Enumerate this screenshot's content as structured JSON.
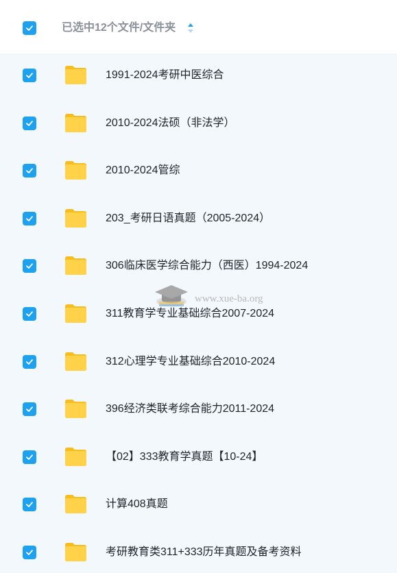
{
  "header": {
    "selection_text": "已选中12个文件/文件夹",
    "checked": true
  },
  "colors": {
    "accent": "#1ea1ee",
    "folder": "#ffcf3d",
    "row_bg": "#f3f8fd"
  },
  "items": [
    {
      "label": "1991-2024考研中医综合",
      "checked": true,
      "icon": "folder-icon"
    },
    {
      "label": "2010-2024法硕（非法学）",
      "checked": true,
      "icon": "folder-icon"
    },
    {
      "label": "2010-2024管综",
      "checked": true,
      "icon": "folder-icon"
    },
    {
      "label": "203_考研日语真题（2005-2024）",
      "checked": true,
      "icon": "folder-icon"
    },
    {
      "label": "306临床医学综合能力（西医）1994-2024",
      "checked": true,
      "icon": "folder-icon"
    },
    {
      "label": "311教育学专业基础综合2007-2024",
      "checked": true,
      "icon": "folder-icon"
    },
    {
      "label": "312心理学专业基础综合2010-2024",
      "checked": true,
      "icon": "folder-icon"
    },
    {
      "label": "396经济类联考综合能力2011-2024",
      "checked": true,
      "icon": "folder-icon"
    },
    {
      "label": "【02】333教育学真题【10-24】",
      "checked": true,
      "icon": "folder-icon"
    },
    {
      "label": "计算408真题",
      "checked": true,
      "icon": "folder-icon"
    },
    {
      "label": "考研教育类311+333历年真题及备考资料",
      "checked": true,
      "icon": "folder-icon"
    }
  ],
  "watermark": {
    "text": "www.xue-ba.org"
  }
}
